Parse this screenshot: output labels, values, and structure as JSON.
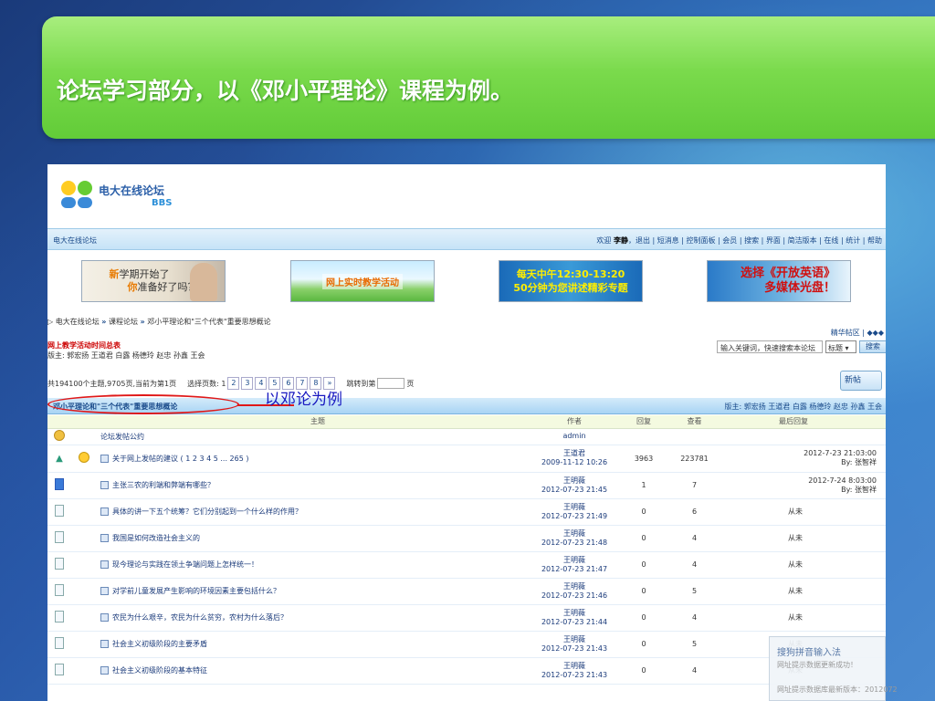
{
  "slide": {
    "title": "论坛学习部分，以《邓小平理论》课程为例。"
  },
  "logo": {
    "name": "电大在线论坛",
    "bbs": "BBS"
  },
  "navbar": {
    "left": "电大在线论坛",
    "welcome": "欢迎",
    "user": "李静",
    "links": "，退出 | 短消息 | 控制面板 | 会员 | 搜索 | 界面 | 简洁版本 | 在线 | 统计 | 帮助"
  },
  "ads": {
    "ad1_line1_hot": "新",
    "ad1_line1": "学期开始了",
    "ad1_line2_hot": "你",
    "ad1_line2": "准备好了吗？",
    "ad2": "网上实时教学活动",
    "ad3_line1": "每天中午12:30-13:20",
    "ad3_line2": "50分钟为您讲述精彩专题",
    "ad4_line1": "选择《开放英语》",
    "ad4_line2": "多媒体光盘！"
  },
  "breadcrumb": {
    "items": [
      "电大在线论坛",
      "课程论坛",
      "邓小平理论和\"三个代表\"重要思想概论"
    ],
    "separator": "»"
  },
  "best_zone": "精华帖区 | ◆◆◆",
  "forum_info": {
    "notice": "网上教学活动时间总表",
    "moderators": "版主: 郭宏扬 王道君 白露 杨德玲 赵忠 孙鑫 王会"
  },
  "search": {
    "placeholder": "输入关键词，快速搜索本论坛",
    "type": "标题",
    "button": "搜索"
  },
  "pager": {
    "summary": "共194100个主题,9705页,当前为第1页",
    "select_label": "选择页数: 1",
    "pages": [
      "2",
      "3",
      "4",
      "5",
      "6",
      "7",
      "8",
      "»"
    ],
    "jump_label": "跳转到第",
    "jump_suffix": "页"
  },
  "new_post": "新帖",
  "annotation": "以邓论为例",
  "forum_header": {
    "name": "邓小平理论和\"三个代表\"重要思想概论",
    "moderators": "版主: 郭宏扬 王道君 白露 杨德玲 赵忠 孙鑫 王会"
  },
  "table": {
    "headers": [
      "主题",
      "作者",
      "回复",
      "查看",
      "最后回复"
    ],
    "rule_row": {
      "title": "论坛发帖公约",
      "author": "admin"
    },
    "rows": [
      {
        "title": "关于网上发帖的建议",
        "pagelinks": "( 1 2 3 4 5 ... 265 )",
        "author": "王道君",
        "date": "2009-11-12 10:26",
        "replies": "3963",
        "views": "223781",
        "last_time": "2012-7-23 21:03:00",
        "last_by": "By: 张智祥"
      },
      {
        "title": "主张三农的利端和弊端有哪些？",
        "author": "王明薇",
        "date": "2012-07-23 21:45",
        "replies": "1",
        "views": "7",
        "last_time": "2012-7-24 8:03:00",
        "last_by": "By: 张智祥"
      },
      {
        "title": "具体的讲一下五个统筹？它们分别起到一个什么样的作用？",
        "author": "王明薇",
        "date": "2012-07-23 21:49",
        "replies": "0",
        "views": "6",
        "last_time": "从未"
      },
      {
        "title": "我国是如何改造社会主义的",
        "author": "王明薇",
        "date": "2012-07-23 21:48",
        "replies": "0",
        "views": "4",
        "last_time": "从未"
      },
      {
        "title": "现今理论与实践在领土争端问题上怎样统一！",
        "author": "王明薇",
        "date": "2012-07-23 21:47",
        "replies": "0",
        "views": "4",
        "last_time": "从未"
      },
      {
        "title": "对学前儿童发展产生影响的环境因素主要包括什么？",
        "author": "王明薇",
        "date": "2012-07-23 21:46",
        "replies": "0",
        "views": "5",
        "last_time": "从未"
      },
      {
        "title": "农民为什么艰辛，农民为什么贫穷，农村为什么落后？",
        "author": "王明薇",
        "date": "2012-07-23 21:44",
        "replies": "0",
        "views": "4",
        "last_time": "从未"
      },
      {
        "title": "社会主义初级阶段的主要矛盾",
        "author": "王明薇",
        "date": "2012-07-23 21:43",
        "replies": "0",
        "views": "5",
        "last_time": "从未"
      },
      {
        "title": "社会主义初级阶段的基本特征",
        "author": "王明薇",
        "date": "2012-07-23 21:43",
        "replies": "0",
        "views": "4",
        "last_time": "从未"
      }
    ]
  },
  "ime_popup": {
    "title": "搜狗拼音输入法",
    "subtitle": "网址提示数据更新成功！",
    "footer": "网址提示数据库最新版本：2012072"
  },
  "colors": {
    "banner_green": "#7ada4c",
    "annotation_red": "#e01818",
    "link_blue": "#1a4a8a"
  }
}
